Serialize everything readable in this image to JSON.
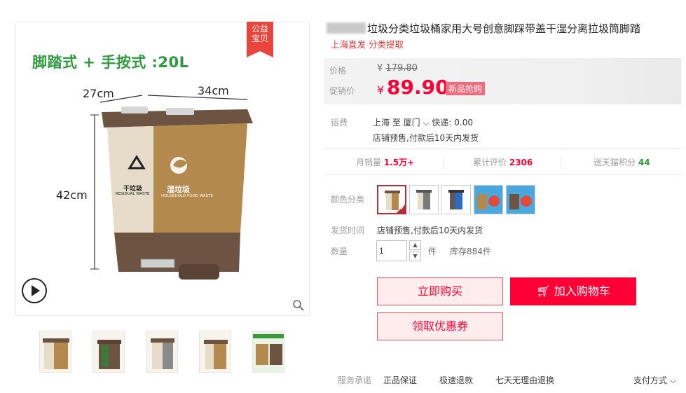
{
  "gallery": {
    "badge": [
      "公益",
      "宝贝"
    ],
    "feature_title": "脚踏式 + 手按式 :20L",
    "dimensions": {
      "width_left": "27cm",
      "width_right": "34cm",
      "height": "42cm"
    },
    "labels": {
      "dry": "干垃圾",
      "dry_en": "RESIDUAL WASTE",
      "wet": "湿垃圾",
      "wet_en": "HOUSEHOLD FOOD WASTE"
    },
    "thumb_count": 5
  },
  "product": {
    "title": "垃圾分类垃圾桶家用大号创意脚踩带盖干湿分离拉圾筒脚踏",
    "subtitle": "上海直发 分类提取"
  },
  "price": {
    "orig_label": "价格",
    "orig_symbol": "¥",
    "orig_value": "179.80",
    "promo_label": "促销价",
    "symbol": "¥",
    "value": "89.90",
    "tag": "新品抢购"
  },
  "shipping": {
    "label": "运费",
    "route": "上海  至  厦门",
    "express": "快递: 0.00",
    "note": "店铺预售,付款后10天内发货"
  },
  "stats": [
    {
      "label": "月销量",
      "value": "1.5万+"
    },
    {
      "label": "累计评价",
      "value": "2306"
    },
    {
      "label": "送天猫积分",
      "value": "44"
    }
  ],
  "options": {
    "color_label": "颜色分类",
    "delivery_label": "发货时间",
    "delivery_value": "店铺预售,付款后10天内发货",
    "qty_label": "数量",
    "qty_value": "1",
    "qty_unit": "件",
    "stock": "库存884件"
  },
  "actions": {
    "buy": "立即购买",
    "cart": "加入购物车",
    "coupon": "领取优惠券"
  },
  "services": {
    "label": "服务承诺",
    "items": [
      "正品保证",
      "极速退款",
      "七天无理由退换"
    ],
    "payment": "支付方式"
  },
  "colors": {
    "accent": "#ff0036",
    "bin_brown": "#7a5a3e",
    "bin_beige": "#e7dcc9",
    "bin_gold": "#b3894d",
    "green": "#2f9a3f"
  }
}
